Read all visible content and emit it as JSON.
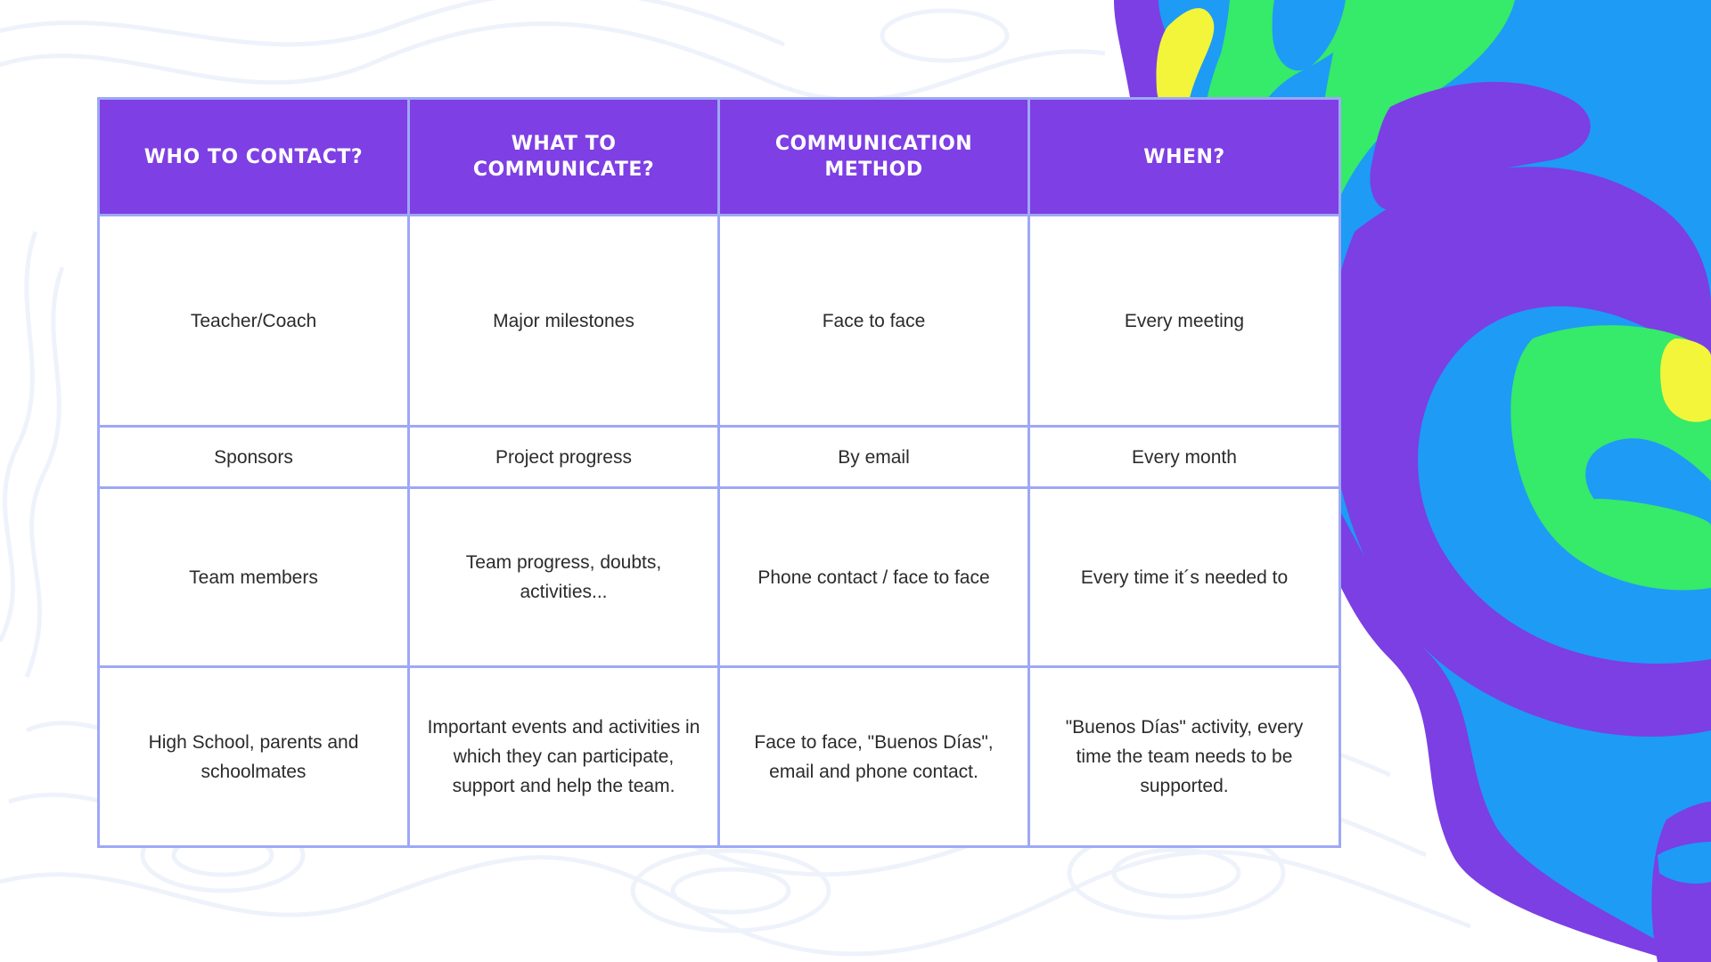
{
  "colors": {
    "header_bg": "#7e3fe4",
    "header_text": "#ffffff",
    "grid_line": "#9ea8f5",
    "cell_text": "#2b2b2b",
    "blob_purple": "#7b3fe4",
    "blob_blue": "#1e9bf5",
    "blob_green": "#36ea6a",
    "blob_yellow": "#f2f53a"
  },
  "table": {
    "headers": [
      "WHO TO CONTACT?",
      "WHAT TO COMMUNICATE?",
      "COMMUNICATION METHOD",
      "WHEN?"
    ],
    "rows": [
      [
        "Teacher/Coach",
        "Major milestones",
        "Face to face",
        "Every meeting"
      ],
      [
        "Sponsors",
        "Project progress",
        "By email",
        "Every month"
      ],
      [
        "Team members",
        "Team progress, doubts, activities...",
        "Phone contact / face to face",
        "Every time it´s needed to"
      ],
      [
        "High School, parents and schoolmates",
        "Important events and activities in which they can participate, support and help the team.",
        "Face to face, \"Buenos Días\", email and phone contact.",
        "\"Buenos Días\" activity, every time the team needs to be supported."
      ]
    ]
  }
}
